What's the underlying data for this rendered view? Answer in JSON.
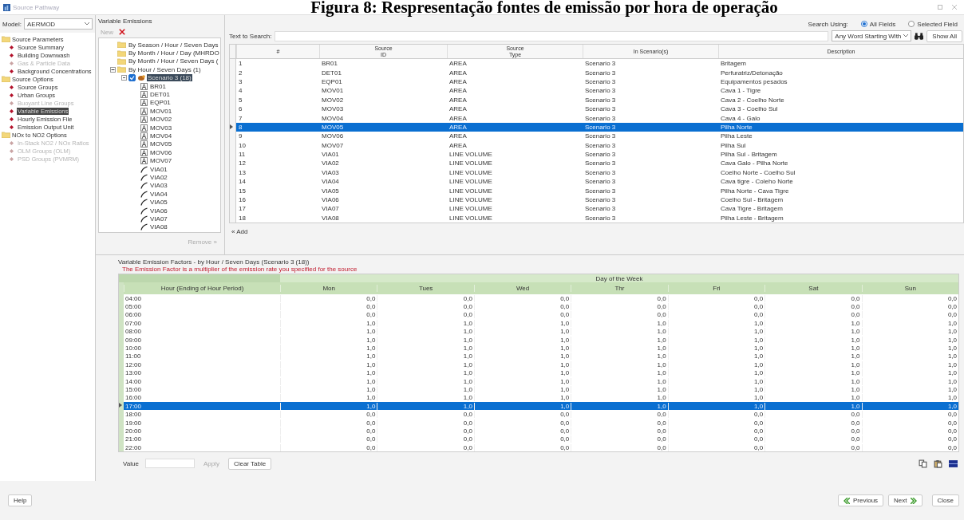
{
  "caption": "Figura 8: Respresentação fontes de emissão por hora de operação",
  "window": {
    "title": "Source Pathway"
  },
  "model": {
    "label": "Model:",
    "value": "AERMOD"
  },
  "sidebar": [
    {
      "label": "Source Parameters",
      "children": [
        {
          "label": "Source Summary",
          "disabled": false,
          "selected": false
        },
        {
          "label": "Building Downwash",
          "disabled": false,
          "selected": false
        },
        {
          "label": "Gas & Particle Data",
          "disabled": true,
          "selected": false
        },
        {
          "label": "Background Concentrations",
          "disabled": false,
          "selected": false
        }
      ]
    },
    {
      "label": "Source Options",
      "children": [
        {
          "label": "Source Groups",
          "disabled": false,
          "selected": false
        },
        {
          "label": "Urban Groups",
          "disabled": false,
          "selected": false
        },
        {
          "label": "Buoyant Line Groups",
          "disabled": true,
          "selected": false
        },
        {
          "label": "Variable Emissions",
          "disabled": false,
          "selected": true
        },
        {
          "label": "Hourly Emission File",
          "disabled": false,
          "selected": false
        },
        {
          "label": "Emission Output Unit",
          "disabled": false,
          "selected": false
        }
      ]
    },
    {
      "label": "NOx to NO2 Options",
      "children": [
        {
          "label": "In-Stack NO2 / NOx Ratios",
          "disabled": true,
          "selected": false
        },
        {
          "label": "OLM Groups (OLM)",
          "disabled": true,
          "selected": false
        },
        {
          "label": "PSD Groups (PVMRM)",
          "disabled": true,
          "selected": false
        }
      ]
    }
  ],
  "variable_emissions": {
    "title": "Variable Emissions",
    "new_button": "New",
    "remove_button": "Remove »",
    "add_button": "« Add",
    "tree": [
      {
        "label": "By Season / Hour / Seven Days"
      },
      {
        "label": "By Month / Hour / Day (MHRDO"
      },
      {
        "label": "By Month / Hour / Seven Days ("
      },
      {
        "label": "By Hour / Seven Days (1)",
        "expanded": true,
        "children": [
          {
            "label": "Scenario 3 (18)",
            "expanded": true,
            "checked": true,
            "selected": true,
            "children": [
              {
                "label": "BR01",
                "kind": "area"
              },
              {
                "label": "DET01",
                "kind": "area"
              },
              {
                "label": "EQP01",
                "kind": "area"
              },
              {
                "label": "MOV01",
                "kind": "area"
              },
              {
                "label": "MOV02",
                "kind": "area"
              },
              {
                "label": "MOV03",
                "kind": "area"
              },
              {
                "label": "MOV04",
                "kind": "area"
              },
              {
                "label": "MOV05",
                "kind": "area"
              },
              {
                "label": "MOV06",
                "kind": "area"
              },
              {
                "label": "MOV07",
                "kind": "area"
              },
              {
                "label": "VIA01",
                "kind": "line"
              },
              {
                "label": "VIA02",
                "kind": "line"
              },
              {
                "label": "VIA03",
                "kind": "line"
              },
              {
                "label": "VIA04",
                "kind": "line"
              },
              {
                "label": "VIA05",
                "kind": "line"
              },
              {
                "label": "VIA06",
                "kind": "line"
              },
              {
                "label": "VIA07",
                "kind": "line"
              },
              {
                "label": "VIA08",
                "kind": "line"
              }
            ]
          }
        ]
      }
    ]
  },
  "search": {
    "using_label": "Search Using:",
    "options": [
      {
        "label": "All Fields",
        "selected": true
      },
      {
        "label": "Selected Field",
        "selected": false
      }
    ],
    "label": "Text to Search:",
    "mode": "Any Word Starting With",
    "show_all": "Show All"
  },
  "table": {
    "columns": [
      "#",
      "Source\nID",
      "Source\nType",
      "In Scenario(s)",
      "Description"
    ],
    "rows": [
      {
        "cells": [
          "1",
          "BR01",
          "AREA",
          "Scenario 3",
          "Britagem"
        ],
        "selected": false
      },
      {
        "cells": [
          "2",
          "DET01",
          "AREA",
          "Scenario 3",
          "Perfuratriz/Detonação"
        ],
        "selected": false
      },
      {
        "cells": [
          "3",
          "EQP01",
          "AREA",
          "Scenario 3",
          "Equipamentos pesados"
        ],
        "selected": false
      },
      {
        "cells": [
          "4",
          "MOV01",
          "AREA",
          "Scenario 3",
          "Cava 1 - Tigre"
        ],
        "selected": false
      },
      {
        "cells": [
          "5",
          "MOV02",
          "AREA",
          "Scenario 3",
          "Cava 2 - Coelho Norte"
        ],
        "selected": false
      },
      {
        "cells": [
          "6",
          "MOV03",
          "AREA",
          "Scenario 3",
          "Cava 3 - Coelho Sul"
        ],
        "selected": false
      },
      {
        "cells": [
          "7",
          "MOV04",
          "AREA",
          "Scenario 3",
          "Cava 4 - Galo"
        ],
        "selected": false
      },
      {
        "cells": [
          "8",
          "MOV05",
          "AREA",
          "Scenario 3",
          "Pilha Norte"
        ],
        "selected": true
      },
      {
        "cells": [
          "9",
          "MOV06",
          "AREA",
          "Scenario 3",
          "Pilha Leste"
        ],
        "selected": false
      },
      {
        "cells": [
          "10",
          "MOV07",
          "AREA",
          "Scenario 3",
          "Pilha Sul"
        ],
        "selected": false
      },
      {
        "cells": [
          "11",
          "VIA01",
          "LINE VOLUME",
          "Scenario 3",
          "Pilha Sul - Britagem"
        ],
        "selected": false
      },
      {
        "cells": [
          "12",
          "VIA02",
          "LINE VOLUME",
          "Scenario 3",
          "Cava Galo - Pilha Norte"
        ],
        "selected": false
      },
      {
        "cells": [
          "13",
          "VIA03",
          "LINE VOLUME",
          "Scenario 3",
          "Coelho Norte - Coelho Sul"
        ],
        "selected": false
      },
      {
        "cells": [
          "14",
          "VIA04",
          "LINE VOLUME",
          "Scenario 3",
          "Cava tigre - Coleho Norte"
        ],
        "selected": false
      },
      {
        "cells": [
          "15",
          "VIA05",
          "LINE VOLUME",
          "Scenario 3",
          "Pilha Norte - Cava Tigre"
        ],
        "selected": false
      },
      {
        "cells": [
          "16",
          "VIA06",
          "LINE VOLUME",
          "Scenario 3",
          "Coelho Sul - Britagem"
        ],
        "selected": false
      },
      {
        "cells": [
          "17",
          "VIA07",
          "LINE VOLUME",
          "Scenario 3",
          "Cava Tigre - Britagem"
        ],
        "selected": false
      },
      {
        "cells": [
          "18",
          "VIA08",
          "LINE VOLUME",
          "Scenario 3",
          "Pilha Leste - Britagem"
        ],
        "selected": false
      }
    ]
  },
  "factors": {
    "title": "Variable Emission Factors - by Hour / Seven Days (Scenario 3 (18))",
    "note": "The Emission Factor is a multiplier of the emission rate you specified for the source",
    "group_header": "Day of the Week",
    "columns": [
      "Hour (Ending of Hour Period)",
      "Mon",
      "Tues",
      "Wed",
      "Thr",
      "Fri",
      "Sat",
      "Sun"
    ],
    "rows": [
      {
        "cells": [
          "04:00",
          "0,0",
          "0,0",
          "0,0",
          "0,0",
          "0,0",
          "0,0",
          "0,0"
        ],
        "selected": false
      },
      {
        "cells": [
          "05:00",
          "0,0",
          "0,0",
          "0,0",
          "0,0",
          "0,0",
          "0,0",
          "0,0"
        ],
        "selected": false
      },
      {
        "cells": [
          "06:00",
          "0,0",
          "0,0",
          "0,0",
          "0,0",
          "0,0",
          "0,0",
          "0,0"
        ],
        "selected": false
      },
      {
        "cells": [
          "07:00",
          "1,0",
          "1,0",
          "1,0",
          "1,0",
          "1,0",
          "1,0",
          "1,0"
        ],
        "selected": false
      },
      {
        "cells": [
          "08:00",
          "1,0",
          "1,0",
          "1,0",
          "1,0",
          "1,0",
          "1,0",
          "1,0"
        ],
        "selected": false
      },
      {
        "cells": [
          "09:00",
          "1,0",
          "1,0",
          "1,0",
          "1,0",
          "1,0",
          "1,0",
          "1,0"
        ],
        "selected": false
      },
      {
        "cells": [
          "10:00",
          "1,0",
          "1,0",
          "1,0",
          "1,0",
          "1,0",
          "1,0",
          "1,0"
        ],
        "selected": false
      },
      {
        "cells": [
          "11:00",
          "1,0",
          "1,0",
          "1,0",
          "1,0",
          "1,0",
          "1,0",
          "1,0"
        ],
        "selected": false
      },
      {
        "cells": [
          "12:00",
          "1,0",
          "1,0",
          "1,0",
          "1,0",
          "1,0",
          "1,0",
          "1,0"
        ],
        "selected": false
      },
      {
        "cells": [
          "13:00",
          "1,0",
          "1,0",
          "1,0",
          "1,0",
          "1,0",
          "1,0",
          "1,0"
        ],
        "selected": false
      },
      {
        "cells": [
          "14:00",
          "1,0",
          "1,0",
          "1,0",
          "1,0",
          "1,0",
          "1,0",
          "1,0"
        ],
        "selected": false
      },
      {
        "cells": [
          "15:00",
          "1,0",
          "1,0",
          "1,0",
          "1,0",
          "1,0",
          "1,0",
          "1,0"
        ],
        "selected": false
      },
      {
        "cells": [
          "16:00",
          "1,0",
          "1,0",
          "1,0",
          "1,0",
          "1,0",
          "1,0",
          "1,0"
        ],
        "selected": false
      },
      {
        "cells": [
          "17:00",
          "1,0",
          "1,0",
          "1,0",
          "1,0",
          "1,0",
          "1,0",
          "1,0"
        ],
        "selected": true
      },
      {
        "cells": [
          "18:00",
          "0,0",
          "0,0",
          "0,0",
          "0,0",
          "0,0",
          "0,0",
          "0,0"
        ],
        "selected": false
      },
      {
        "cells": [
          "19:00",
          "0,0",
          "0,0",
          "0,0",
          "0,0",
          "0,0",
          "0,0",
          "0,0"
        ],
        "selected": false
      },
      {
        "cells": [
          "20:00",
          "0,0",
          "0,0",
          "0,0",
          "0,0",
          "0,0",
          "0,0",
          "0,0"
        ],
        "selected": false
      },
      {
        "cells": [
          "21:00",
          "0,0",
          "0,0",
          "0,0",
          "0,0",
          "0,0",
          "0,0",
          "0,0"
        ],
        "selected": false
      },
      {
        "cells": [
          "22:00",
          "0,0",
          "0,0",
          "0,0",
          "0,0",
          "0,0",
          "0,0",
          "0,0"
        ],
        "selected": false
      }
    ],
    "value_label": "Value",
    "apply_button": "Apply",
    "clear_button": "Clear Table"
  },
  "footer": {
    "help": "Help",
    "previous": "Previous",
    "next": "Next",
    "close": "Close"
  }
}
